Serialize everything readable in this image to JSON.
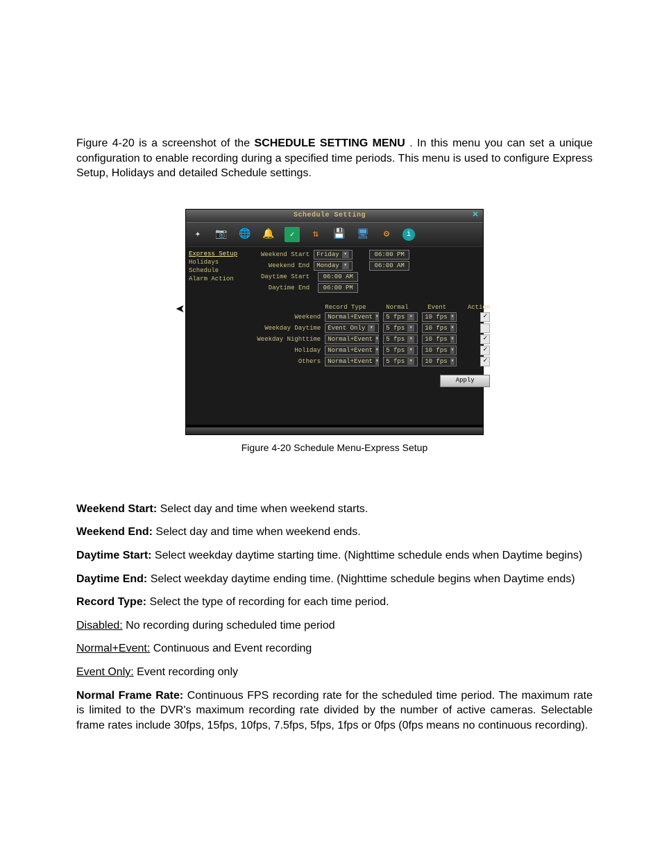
{
  "intro": {
    "before_bold": "Figure 4-20 is a screenshot of the ",
    "bold": "SCHEDULE SETTING MENU",
    "after_bold": ". In this menu you can set a unique configuration to enable recording during a specified time periods.  This menu is used to configure Express Setup, Holidays and detailed Schedule settings."
  },
  "dvr": {
    "title": "Schedule Setting",
    "close_glyph": "×",
    "icons": {
      "sparkle": "✦",
      "camera": "📷",
      "globe": "🌐",
      "bell": "🔔",
      "calendar": "✓",
      "net": "⇅",
      "disk": "💾",
      "display": "🖥",
      "gear": "⚙",
      "info": "i"
    },
    "sidebar": [
      {
        "label": "Express Setup",
        "active": true
      },
      {
        "label": "Holidays",
        "active": false
      },
      {
        "label": "Schedule",
        "active": false
      },
      {
        "label": "Alarm Action",
        "active": false
      }
    ],
    "time_rows": [
      {
        "label": "Weekend Start",
        "day": "Friday",
        "has_day": true,
        "time": "06:00 PM"
      },
      {
        "label": "Weekend End",
        "day": "Monday",
        "has_day": true,
        "time": "06:00 AM"
      },
      {
        "label": "Daytime Start",
        "has_day": false,
        "time": "06:00 AM"
      },
      {
        "label": "Daytime End",
        "has_day": false,
        "time": "06:00 PM"
      }
    ],
    "headers": {
      "record": "Record Type",
      "normal": "Normal",
      "event": "Event",
      "action": "Action"
    },
    "schedule_rows": [
      {
        "label": "Weekend",
        "record": "Normal+Event",
        "normal": "5 fps",
        "event": "10 fps",
        "action_checked": true
      },
      {
        "label": "Weekday Daytime",
        "record": "Event Only",
        "normal": "5 fps",
        "event": "10 fps",
        "action_checked": false
      },
      {
        "label": "Weekday Nighttime",
        "record": "Normal+Event",
        "normal": "5 fps",
        "event": "10 fps",
        "action_checked": true
      },
      {
        "label": "Holiday",
        "record": "Normal+Event",
        "normal": "5 fps",
        "event": "10 fps",
        "action_checked": true
      },
      {
        "label": "Others",
        "record": "Normal+Event",
        "normal": "5 fps",
        "event": "10 fps",
        "action_checked": true
      }
    ],
    "apply": "Apply"
  },
  "caption": "Figure 4-20  Schedule Menu-Express Setup",
  "desc": {
    "weekend_start": {
      "b": "Weekend Start: ",
      "t": "Select day and time when weekend starts."
    },
    "weekend_end": {
      "b": "Weekend End: ",
      "t": "Select day and time when weekend ends."
    },
    "daytime_start": {
      "b": "Daytime Start: ",
      "t": "Select weekday daytime starting time. (Nighttime schedule ends when Daytime begins)"
    },
    "daytime_end": {
      "b": "Daytime End: ",
      "t": "Select weekday daytime ending time. (Nighttime schedule begins when Daytime ends)"
    },
    "record_type": {
      "b": "Record Type: ",
      "t": "Select the type of recording for each time period."
    },
    "opt_disabled": {
      "u": "Disabled:",
      "t": " No recording during scheduled time period"
    },
    "opt_normalevent": {
      "u": "Normal+Event:",
      "t": " Continuous and Event recording"
    },
    "opt_eventonly": {
      "u": "Event Only:",
      "t": " Event recording only"
    },
    "normal_fr": {
      "b": "Normal Frame Rate: ",
      "t": "Continuous FPS recording rate for the scheduled time period. The maximum rate is limited to the DVR's maximum recording rate divided by the number of active cameras. Selectable frame rates include 30fps, 15fps, 10fps, 7.5fps, 5fps, 1fps or 0fps (0fps means no continuous recording)."
    }
  },
  "check_glyph": "✓",
  "dd_arrow": "▾"
}
